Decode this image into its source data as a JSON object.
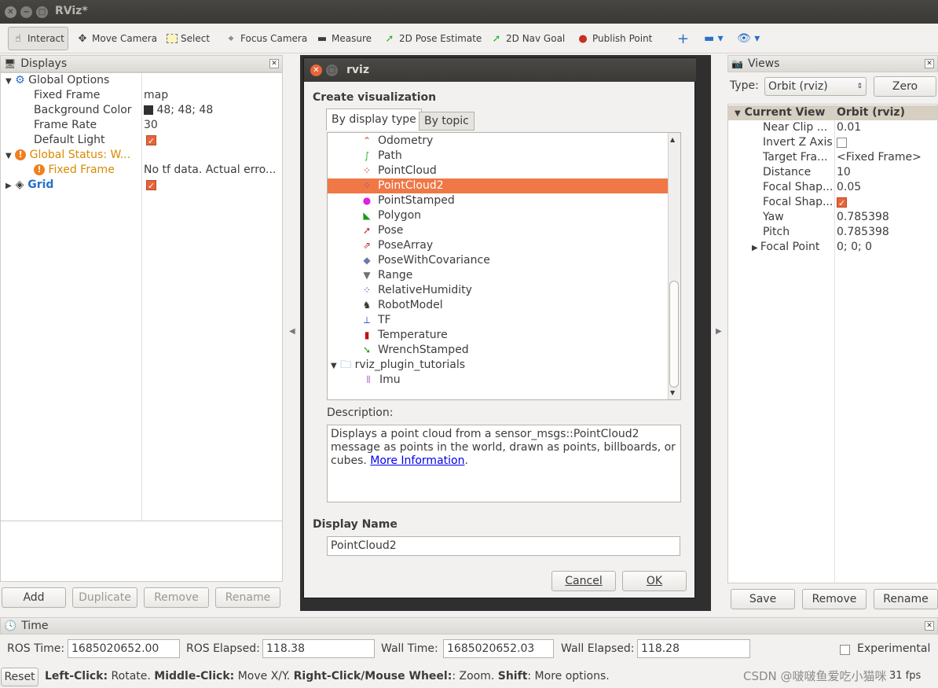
{
  "window": {
    "title": "RViz*"
  },
  "toolbar": {
    "interact": "Interact",
    "move_camera": "Move Camera",
    "select": "Select",
    "focus_camera": "Focus Camera",
    "measure": "Measure",
    "pose_estimate": "2D Pose Estimate",
    "nav_goal": "2D Nav Goal",
    "publish_point": "Publish Point"
  },
  "displays": {
    "header": "Displays",
    "global_options": "Global Options",
    "fixed_frame_label": "Fixed Frame",
    "fixed_frame_value": "map",
    "bg_color_label": "Background Color",
    "bg_color_value": "48; 48; 48",
    "frame_rate_label": "Frame Rate",
    "frame_rate_value": "30",
    "default_light_label": "Default Light",
    "global_status": "Global Status: W...",
    "fixed_frame_warn": "Fixed Frame",
    "fixed_frame_warn_value": "No tf data.  Actual erro...",
    "grid": "Grid",
    "buttons": {
      "add": "Add",
      "duplicate": "Duplicate",
      "remove": "Remove",
      "rename": "Rename"
    }
  },
  "dialog": {
    "title": "rviz",
    "heading": "Create visualization",
    "tab_display_type": "By display type",
    "tab_topic": "By topic",
    "items": [
      {
        "label": "Odometry",
        "icon": "odometry-icon",
        "color": "#e03a2a"
      },
      {
        "label": "Path",
        "icon": "path-icon",
        "color": "#2bb52b"
      },
      {
        "label": "PointCloud",
        "icon": "pointcloud-icon",
        "color": "#c02020"
      },
      {
        "label": "PointCloud2",
        "icon": "pointcloud2-icon",
        "color": "#7a4fb5"
      },
      {
        "label": "PointStamped",
        "icon": "pointstamped-icon",
        "color": "#e020e0"
      },
      {
        "label": "Polygon",
        "icon": "polygon-icon",
        "color": "#1a9a1a"
      },
      {
        "label": "Pose",
        "icon": "pose-icon",
        "color": "#d02020"
      },
      {
        "label": "PoseArray",
        "icon": "posearray-icon",
        "color": "#d02020"
      },
      {
        "label": "PoseWithCovariance",
        "icon": "posewithcovariance-icon",
        "color": "#6a7aa8"
      },
      {
        "label": "Range",
        "icon": "range-icon",
        "color": "#707070"
      },
      {
        "label": "RelativeHumidity",
        "icon": "relativehumidity-icon",
        "color": "#3a3ab5"
      },
      {
        "label": "RobotModel",
        "icon": "robotmodel-icon",
        "color": "#333333"
      },
      {
        "label": "TF",
        "icon": "tf-icon",
        "color": "#3060c0"
      },
      {
        "label": "Temperature",
        "icon": "temperature-icon",
        "color": "#c01010"
      },
      {
        "label": "WrenchStamped",
        "icon": "wrenchstamped-icon",
        "color": "#1a9a1a"
      }
    ],
    "plugin_folder": "rviz_plugin_tutorials",
    "plugin_item": "Imu",
    "description_label": "Description:",
    "description_text": "Displays a point cloud from a sensor_msgs::PointCloud2 message as points in the world, drawn as points, billboards, or cubes. ",
    "more_information": "More Information",
    "display_name_label": "Display Name",
    "display_name_value": "PointCloud2",
    "cancel": "Cancel",
    "ok": "OK"
  },
  "views": {
    "header": "Views",
    "type_label": "Type:",
    "type_value": "Orbit (rviz)",
    "zero": "Zero",
    "current_view": "Current View",
    "current_view_value": "Orbit (rviz)",
    "props": [
      {
        "label": "Near Clip ...",
        "value": "0.01"
      },
      {
        "label": "Invert Z Axis",
        "value": ""
      },
      {
        "label": "Target Fra...",
        "value": "<Fixed Frame>"
      },
      {
        "label": "Distance",
        "value": "10"
      },
      {
        "label": "Focal Shap...",
        "value": "0.05"
      },
      {
        "label": "Focal Shap...",
        "value": ""
      },
      {
        "label": "Yaw",
        "value": "0.785398"
      },
      {
        "label": "Pitch",
        "value": "0.785398"
      },
      {
        "label": "Focal Point",
        "value": "0; 0; 0"
      }
    ],
    "save": "Save",
    "remove": "Remove",
    "rename": "Rename"
  },
  "time": {
    "header": "Time",
    "ros_time_label": "ROS Time:",
    "ros_time": "1685020652.00",
    "ros_elapsed_label": "ROS Elapsed:",
    "ros_elapsed": "118.38",
    "wall_time_label": "Wall Time:",
    "wall_time": "1685020652.03",
    "wall_elapsed_label": "Wall Elapsed:",
    "wall_elapsed": "118.28",
    "experimental": "Experimental"
  },
  "status": {
    "reset": "Reset",
    "b1": "Left-Click:",
    "t1": " Rotate. ",
    "b2": "Middle-Click:",
    "t2": " Move X/Y. ",
    "b3": "Right-Click/Mouse Wheel:",
    "t3": ": Zoom. ",
    "b4": "Shift",
    "t4": ": More options.",
    "fps": "31 fps",
    "watermark": "CSDN @啵啵鱼爱吃小猫咪"
  },
  "colors": {
    "highlight": "#f07746",
    "accent_orange": "#e8643b",
    "link_blue": "#0000ee",
    "warn_orange": "#d98a00",
    "grid_blue": "#2a70c8"
  }
}
